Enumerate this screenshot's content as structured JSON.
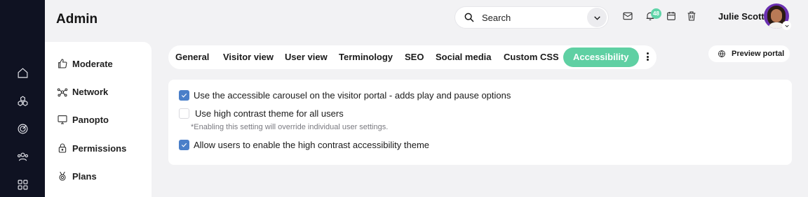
{
  "header": {
    "title": "Admin",
    "search_placeholder": "Search",
    "notification_count": "48",
    "user_name": "Julie Scott"
  },
  "rail": {
    "items": [
      "home-icon",
      "apps-cube-icon",
      "target-icon",
      "users-icon",
      "grid-icon"
    ]
  },
  "sidebar": {
    "items": [
      {
        "label": "Moderate",
        "icon": "thumbs-up-icon"
      },
      {
        "label": "Network",
        "icon": "network-icon"
      },
      {
        "label": "Panopto",
        "icon": "monitor-icon"
      },
      {
        "label": "Permissions",
        "icon": "lock-icon"
      },
      {
        "label": "Plans",
        "icon": "medal-icon"
      }
    ]
  },
  "tabs": {
    "items": [
      "General",
      "Visitor view",
      "User view",
      "Terminology",
      "SEO",
      "Social media",
      "Custom CSS",
      "Accessibility"
    ],
    "active": "Accessibility"
  },
  "preview_portal_label": "Preview portal",
  "settings": {
    "options": [
      {
        "label": "Use the accessible carousel on the visitor portal - adds play and pause options",
        "checked": true
      },
      {
        "label": "Use high contrast theme for all users",
        "checked": false
      },
      {
        "label": "Allow users to enable the high contrast accessibility theme",
        "checked": true
      }
    ],
    "note": "*Enabling this setting will override individual user settings."
  },
  "colors": {
    "accent_green": "#5fd0a3",
    "checkbox_blue": "#4a7fc9",
    "rail_bg": "#0f1222"
  }
}
